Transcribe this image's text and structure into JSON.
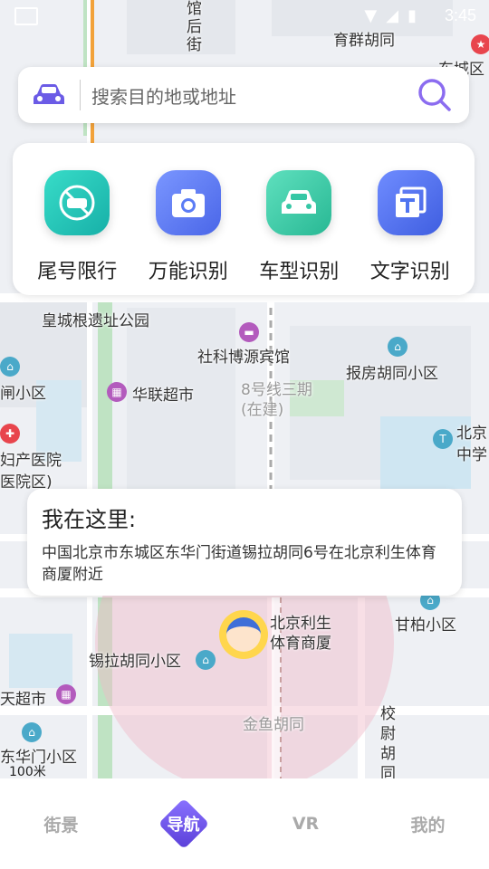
{
  "status_bar": {
    "time": "3:45"
  },
  "search": {
    "placeholder": "搜索目的地或地址"
  },
  "tools": [
    {
      "label": "尾号限行",
      "icon": "no-car-icon",
      "color": "#22c7b8"
    },
    {
      "label": "万能识别",
      "icon": "camera-icon",
      "color": "#5b7cf5"
    },
    {
      "label": "车型识别",
      "icon": "car-icon",
      "color": "#36c7a5"
    },
    {
      "label": "文字识别",
      "icon": "text-icon",
      "color": "#4f74f0"
    }
  ],
  "location_popup": {
    "title": "我在这里:",
    "address": "中国北京市东城区东华门街道锡拉胡同6号在北京利生体育商厦附近"
  },
  "map_labels": {
    "yuqun": "育群胡同",
    "dongcheng": "东城区",
    "huangcheng": "皇城根遗址公园",
    "sheke": "社科博源宾馆",
    "baofang": "报房胡同小区",
    "hualian": "华联超市",
    "line8": "8号线三期(在建)",
    "beijing": "北京",
    "zhongxue": "中学",
    "lisheng": "北京利生体育商厦",
    "xila": "锡拉胡同小区",
    "ganyu": "甘柏小区",
    "tianchaoshi": "天超市",
    "jinyu": "金鱼胡同",
    "xiaowei": "校尉胡同",
    "dongmen": "东华门小区",
    "chanyuan": "妇产医院",
    "yuanqu": "医院区)",
    "guanhou": "馆后街",
    "xiaoqu_left": "闸小区"
  },
  "scale": "100米",
  "tabs": [
    {
      "label": "街景"
    },
    {
      "label": "导航"
    },
    {
      "label": "VR"
    },
    {
      "label": "我的"
    }
  ]
}
